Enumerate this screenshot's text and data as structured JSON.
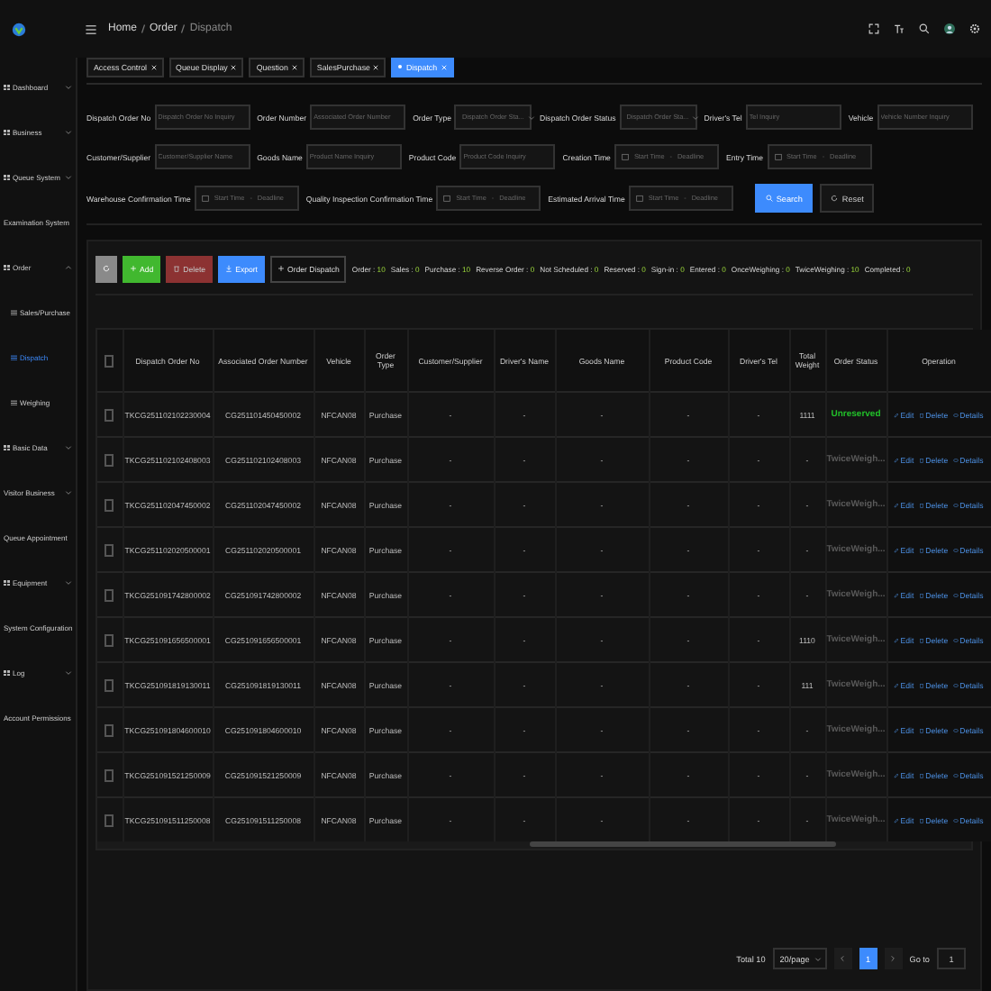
{
  "breadcrumb": [
    "Home",
    "Order",
    "Dispatch"
  ],
  "tabs": [
    {
      "label": "Access Control",
      "selected": false
    },
    {
      "label": "Queue Display",
      "selected": false
    },
    {
      "label": "Question",
      "selected": false
    },
    {
      "label": "SalesPurchase",
      "selected": false
    },
    {
      "label": "Dispatch",
      "selected": true
    }
  ],
  "sidebar": {
    "items": [
      {
        "label": "Dashboard",
        "icon": true,
        "expanded": false
      },
      {
        "label": "Business",
        "icon": true,
        "expanded": false
      },
      {
        "label": "Queue System",
        "icon": true,
        "expanded": false
      },
      {
        "label": "Examination System",
        "icon": false
      },
      {
        "label": "Order",
        "icon": true,
        "expanded": true,
        "children": [
          {
            "label": "Sales/Purchase",
            "selected": false
          },
          {
            "label": "Dispatch",
            "selected": true
          },
          {
            "label": "Weighing",
            "selected": false
          }
        ]
      },
      {
        "label": "Basic Data",
        "icon": true,
        "expanded": false
      },
      {
        "label": "Visitor Business",
        "icon": false,
        "expanded": false
      },
      {
        "label": "Queue Appointment",
        "icon": false
      },
      {
        "label": "Equipment",
        "icon": true,
        "expanded": false
      },
      {
        "label": "System Configuration",
        "icon": false
      },
      {
        "label": "Log",
        "icon": true,
        "expanded": false
      },
      {
        "label": "Account Permissions",
        "icon": false
      }
    ]
  },
  "filters": [
    [
      {
        "kind": "input",
        "label": "Dispatch Order No",
        "placeholder": "Dispatch Order No Inquiry"
      },
      {
        "kind": "input",
        "label": "Order Number",
        "placeholder": "Associated Order Number"
      },
      {
        "kind": "select",
        "label": "Order Type",
        "placeholder": "Dispatch Order Sta..."
      },
      {
        "kind": "select",
        "label": "Dispatch Order Status",
        "placeholder": "Dispatch Order Sta..."
      },
      {
        "kind": "input",
        "label": "Driver's Tel",
        "placeholder": "Tel Inquiry"
      },
      {
        "kind": "input",
        "label": "Vehicle",
        "placeholder": "Vehicle Number Inquiry"
      }
    ],
    [
      {
        "kind": "input",
        "label": "Customer/Supplier",
        "placeholder": "Customer/Supplier Name"
      },
      {
        "kind": "input",
        "label": "Goods Name",
        "placeholder": "Product Name Inquiry"
      },
      {
        "kind": "input",
        "label": "Product Code",
        "placeholder": "Product Code Inquiry"
      },
      {
        "kind": "daterange",
        "label": "Creation Time",
        "placeholder": "Start Time",
        "separator": "-",
        "end_placeholder": "Deadline"
      },
      {
        "kind": "daterange",
        "label": "Entry Time",
        "placeholder": "Start Time",
        "separator": "-",
        "end_placeholder": "Deadline"
      }
    ],
    [
      {
        "kind": "daterange",
        "label": "Warehouse Confirmation Time",
        "placeholder": "Start Time",
        "separator": "-",
        "end_placeholder": "Deadline"
      },
      {
        "kind": "daterange",
        "label": "Quality Inspection Confirmation Time",
        "placeholder": "Start Time",
        "separator": "-",
        "end_placeholder": "Deadline"
      },
      {
        "kind": "daterange",
        "label": "Estimated Arrival Time",
        "placeholder": "Start Time",
        "separator": "-",
        "end_placeholder": "Deadline"
      }
    ]
  ],
  "filter_buttons": [
    {
      "kind": "primary",
      "label": "Search"
    },
    {
      "kind": "plain",
      "label": "Reset"
    }
  ],
  "toolbar": [
    {
      "kind": "refresh"
    },
    {
      "kind": "add",
      "label": "Add"
    },
    {
      "kind": "delete",
      "label": "Delete",
      "disabled": true
    },
    {
      "kind": "export",
      "label": "Export"
    },
    {
      "kind": "outline",
      "label": "Order Dispatch"
    }
  ],
  "counts": [
    {
      "label": "Order :",
      "value": "10"
    },
    {
      "label": "Sales :",
      "value": "0"
    },
    {
      "label": "Purchase :",
      "value": "10"
    },
    {
      "label": "Reverse Order :",
      "value": "0"
    },
    {
      "label": "Not Scheduled :",
      "value": "0"
    },
    {
      "label": "Reserved :",
      "value": "0"
    },
    {
      "label": "Sign-in :",
      "value": "0"
    },
    {
      "label": "Entered :",
      "value": "0"
    },
    {
      "label": "OnceWeighing :",
      "value": "0"
    },
    {
      "label": "TwiceWeighing :",
      "value": "10"
    },
    {
      "label": "Completed :",
      "value": "0"
    }
  ],
  "table": {
    "all_checked": false,
    "columns": [
      "Dispatch Order No",
      "Associated Order Number",
      "Vehicle",
      "Order Type",
      "Customer/Supplier",
      "Driver's Name",
      "Goods Name",
      "Product Code",
      "Driver's Tel",
      "Total Weight",
      "Order Status",
      "Operation"
    ],
    "rows": [
      {
        "checked": false,
        "cells": [
          "TKCG251102102230004",
          "CG251101450450002",
          "NFCAN08",
          "Purchase",
          "-",
          "-",
          "-",
          "-",
          "-",
          "1111"
        ],
        "status": {
          "text": "Unreserved",
          "color": "#22c02a"
        },
        "actions": [
          "Edit",
          "Delete",
          "Details"
        ]
      },
      {
        "checked": false,
        "cells": [
          "TKCG251102102408003",
          "CG251102102408003",
          "NFCAN08",
          "Purchase",
          "-",
          "-",
          "-",
          "-",
          "-",
          "-"
        ],
        "status": {
          "text": "TwiceWeigh...",
          "color": "#5a5a5a"
        },
        "actions": [
          "Edit",
          "Delete",
          "Details"
        ]
      },
      {
        "checked": false,
        "cells": [
          "TKCG251102047450002",
          "CG251102047450002",
          "NFCAN08",
          "Purchase",
          "-",
          "-",
          "-",
          "-",
          "-",
          "-"
        ],
        "status": {
          "text": "TwiceWeigh...",
          "color": "#5a5a5a"
        },
        "actions": [
          "Edit",
          "Delete",
          "Details"
        ]
      },
      {
        "checked": false,
        "cells": [
          "TKCG251102020500001",
          "CG251102020500001",
          "NFCAN08",
          "Purchase",
          "-",
          "-",
          "-",
          "-",
          "-",
          "-"
        ],
        "status": {
          "text": "TwiceWeigh...",
          "color": "#5a5a5a"
        },
        "actions": [
          "Edit",
          "Delete",
          "Details"
        ]
      },
      {
        "checked": false,
        "cells": [
          "TKCG251091742800002",
          "CG251091742800002",
          "NFCAN08",
          "Purchase",
          "-",
          "-",
          "-",
          "-",
          "-",
          "-"
        ],
        "status": {
          "text": "TwiceWeigh...",
          "color": "#5a5a5a"
        },
        "actions": [
          "Edit",
          "Delete",
          "Details"
        ]
      },
      {
        "checked": false,
        "cells": [
          "TKCG251091656500001",
          "CG251091656500001",
          "NFCAN08",
          "Purchase",
          "-",
          "-",
          "-",
          "-",
          "-",
          "1110"
        ],
        "status": {
          "text": "TwiceWeigh...",
          "color": "#5a5a5a"
        },
        "actions": [
          "Edit",
          "Delete",
          "Details"
        ]
      },
      {
        "checked": false,
        "cells": [
          "TKCG251091819130011",
          "CG251091819130011",
          "NFCAN08",
          "Purchase",
          "-",
          "-",
          "-",
          "-",
          "-",
          "111"
        ],
        "status": {
          "text": "TwiceWeigh...",
          "color": "#5a5a5a"
        },
        "actions": [
          "Edit",
          "Delete",
          "Details"
        ]
      },
      {
        "checked": false,
        "cells": [
          "TKCG251091804600010",
          "CG251091804600010",
          "NFCAN08",
          "Purchase",
          "-",
          "-",
          "-",
          "-",
          "-",
          "-"
        ],
        "status": {
          "text": "TwiceWeigh...",
          "color": "#5a5a5a"
        },
        "actions": [
          "Edit",
          "Delete",
          "Details"
        ]
      },
      {
        "checked": false,
        "cells": [
          "TKCG251091521250009",
          "CG251091521250009",
          "NFCAN08",
          "Purchase",
          "-",
          "-",
          "-",
          "-",
          "-",
          "-"
        ],
        "status": {
          "text": "TwiceWeigh...",
          "color": "#5a5a5a"
        },
        "actions": [
          "Edit",
          "Delete",
          "Details"
        ]
      },
      {
        "checked": false,
        "cells": [
          "TKCG251091511250008",
          "CG251091511250008",
          "NFCAN08",
          "Purchase",
          "-",
          "-",
          "-",
          "-",
          "-",
          "-"
        ],
        "status": {
          "text": "TwiceWeigh...",
          "color": "#5a5a5a"
        },
        "actions": [
          "Edit",
          "Delete",
          "Details"
        ]
      }
    ]
  },
  "pagination": {
    "total": "Total 10",
    "page_size": "20/page",
    "pages": [
      {
        "label": "1",
        "selected": true
      }
    ],
    "goto_label": "Go to",
    "goto_value": "1"
  }
}
